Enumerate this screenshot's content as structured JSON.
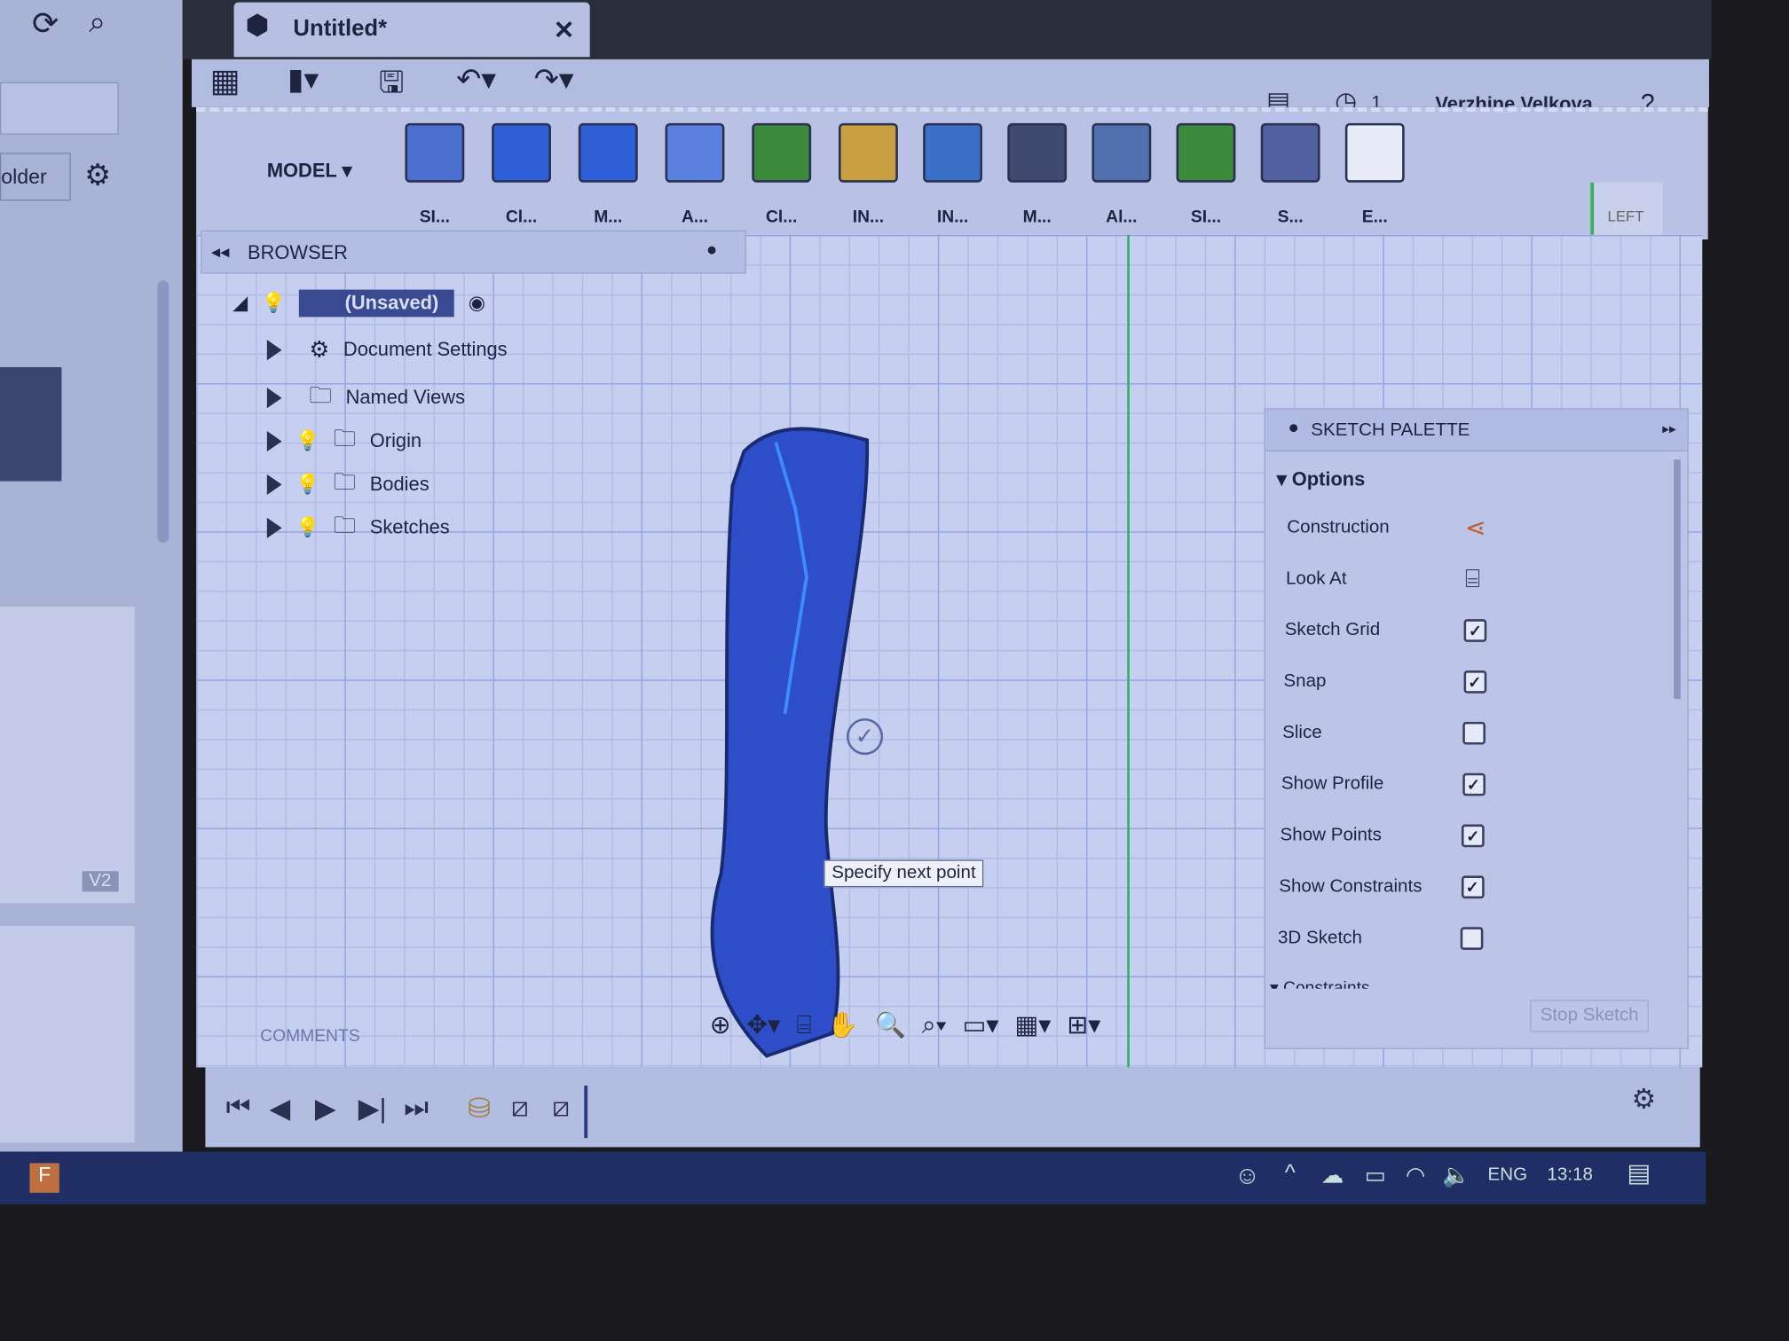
{
  "window": {
    "tab_title": "Untitled*"
  },
  "left_panel": {
    "folder_button": "older",
    "version_badge": "V2"
  },
  "toolbar": {
    "workspace": "MODEL",
    "user": "Verzhine Velkova",
    "jobs_count": "1",
    "tools": [
      {
        "label": "SI...",
        "icon": "sketch-icon",
        "color": "#4a6fd0"
      },
      {
        "label": "Cl...",
        "icon": "create-icon",
        "color": "#2f5fd8"
      },
      {
        "label": "M...",
        "icon": "modify-icon",
        "color": "#2f5fd8"
      },
      {
        "label": "A...",
        "icon": "assemble-icon",
        "color": "#5a80e0"
      },
      {
        "label": "Cl...",
        "icon": "construct-icon",
        "color": "#3c8a3c"
      },
      {
        "label": "IN...",
        "icon": "inspect-icon",
        "color": "#c8a040"
      },
      {
        "label": "IN...",
        "icon": "insert-icon",
        "color": "#3a70c8"
      },
      {
        "label": "M...",
        "icon": "make-icon",
        "color": "#404a70"
      },
      {
        "label": "Al...",
        "icon": "addins-icon",
        "color": "#5070b0"
      },
      {
        "label": "SI...",
        "icon": "select-icon",
        "color": "#3c8a3c"
      },
      {
        "label": "S...",
        "icon": "sheet-metal-icon",
        "color": "#5060a0"
      },
      {
        "label": "E...",
        "icon": "stop-sketch-icon",
        "color": "#e8ecf8"
      }
    ]
  },
  "browser": {
    "title": "BROWSER",
    "root": "(Unsaved)",
    "items": [
      {
        "label": "Document Settings",
        "icon": "gear-icon"
      },
      {
        "label": "Named Views",
        "icon": "folder-icon"
      },
      {
        "label": "Origin",
        "icon": "folder-icon"
      },
      {
        "label": "Bodies",
        "icon": "folder-icon"
      },
      {
        "label": "Sketches",
        "icon": "folder-icon"
      }
    ]
  },
  "viewcube": {
    "face": "LEFT",
    "axis": "Z"
  },
  "tooltip": "Specify next point",
  "comments": "COMMENTS",
  "sketch_palette": {
    "title": "SKETCH PALETTE",
    "section": "Options",
    "next_section": "Constraints",
    "stop_button": "Stop Sketch",
    "options": [
      {
        "label": "Construction",
        "type": "icon"
      },
      {
        "label": "Look At",
        "type": "icon"
      },
      {
        "label": "Sketch Grid",
        "checked": true
      },
      {
        "label": "Snap",
        "checked": true
      },
      {
        "label": "Slice",
        "checked": false
      },
      {
        "label": "Show Profile",
        "checked": true
      },
      {
        "label": "Show Points",
        "checked": true
      },
      {
        "label": "Show Constraints",
        "checked": true
      },
      {
        "label": "3D Sketch",
        "checked": false
      }
    ]
  },
  "taskbar": {
    "language": "ENG",
    "time": "13:18"
  }
}
